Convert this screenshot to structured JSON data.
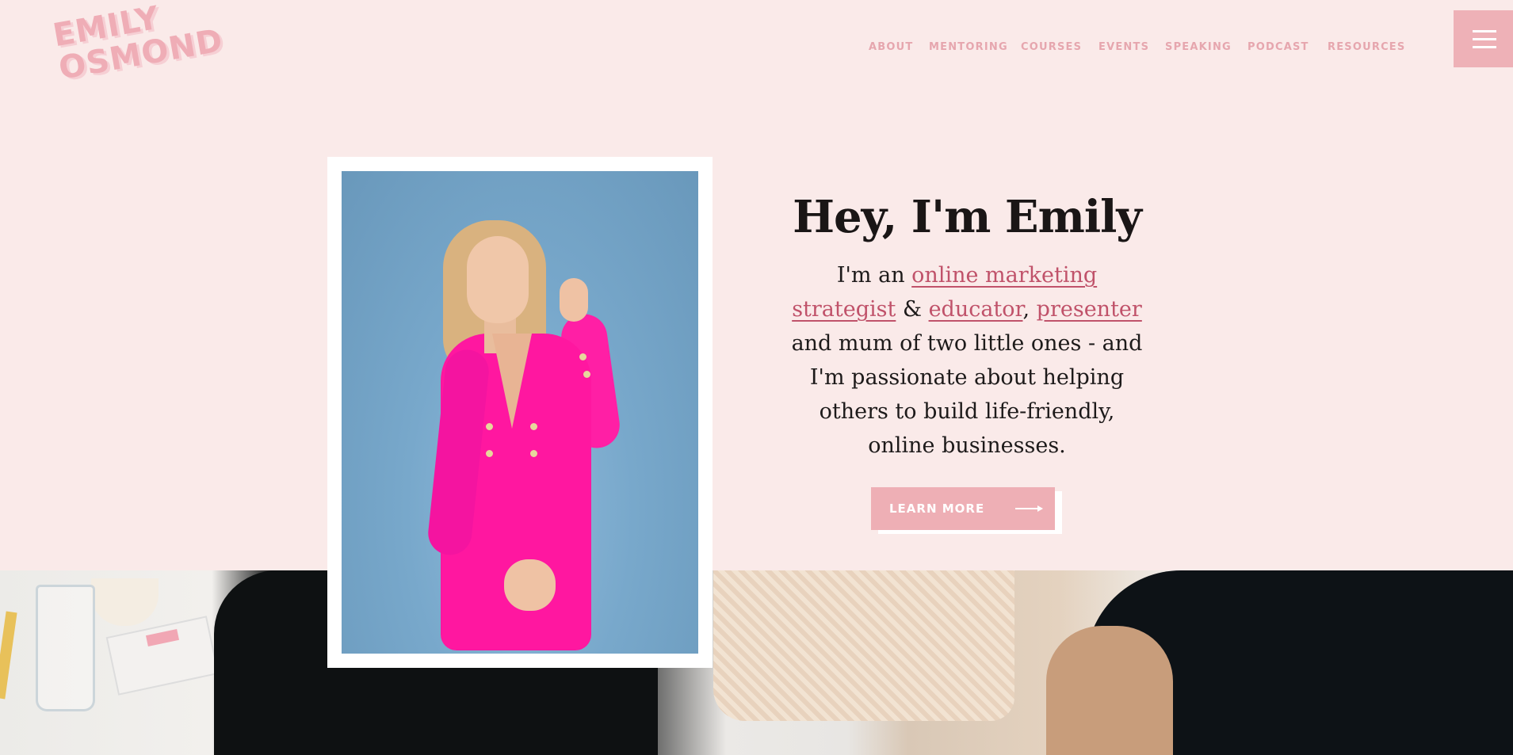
{
  "brand": {
    "logo_line1": "EMILY",
    "logo_line2": "OSMOND",
    "accent": "#efadb6",
    "background": "#faeae9",
    "link_color": "#c0526a"
  },
  "nav": {
    "items": [
      {
        "label": "ABOUT"
      },
      {
        "label": "MENTORING"
      },
      {
        "label": "COURSES"
      },
      {
        "label": "EVENTS"
      },
      {
        "label": "SPEAKING"
      },
      {
        "label": "PODCAST"
      },
      {
        "label": "RESOURCES"
      }
    ],
    "menu_icon": "hamburger-icon"
  },
  "hero": {
    "title": "Hey, I'm Emily",
    "intro_1": "I'm an ",
    "link_strategist": "online marketing strategist",
    "connector_1": " & ",
    "link_educator": "educator",
    "connector_2": ",",
    "link_presenter": "presenter",
    "body_rest": " and mum of two little ones - and I'm passionate about helping others to build life-friendly, online businesses.",
    "cta_label": "LEARN MORE",
    "cta_icon": "arrow-right-icon"
  }
}
